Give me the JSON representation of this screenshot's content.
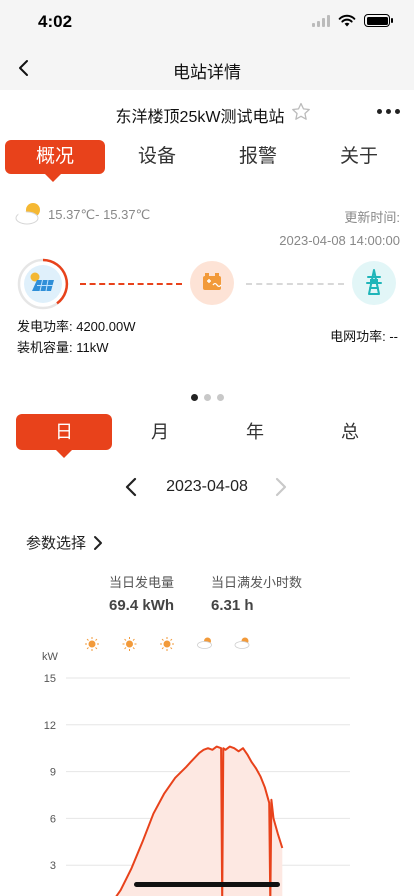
{
  "status_bar": {
    "time": "4:02"
  },
  "nav": {
    "title": "电站详情"
  },
  "station": {
    "name": "东洋楼顶25kW测试电站"
  },
  "main_tabs": [
    {
      "label": "概况",
      "active": true
    },
    {
      "label": "设备",
      "active": false
    },
    {
      "label": "报警",
      "active": false
    },
    {
      "label": "关于",
      "active": false
    }
  ],
  "weather": {
    "icon": "partly-cloudy-icon",
    "temperature": "15.37℃- 15.37℃"
  },
  "update": {
    "label": "更新时间:",
    "value": "2023-04-08 14:00:00"
  },
  "flow": {
    "solar_icon": "solar-panel-icon",
    "inverter_icon": "inverter-icon",
    "grid_icon": "grid-tower-icon",
    "generation_power": "发电功率: 4200.00W",
    "installed_capacity": "装机容量: 11kW",
    "grid_power": "电网功率: --"
  },
  "pager": {
    "count": 3,
    "active_index": 0
  },
  "period_tabs": [
    {
      "label": "日",
      "active": true
    },
    {
      "label": "月",
      "active": false
    },
    {
      "label": "年",
      "active": false
    },
    {
      "label": "总",
      "active": false
    }
  ],
  "date": {
    "value": "2023-04-08"
  },
  "param": {
    "label": "参数选择"
  },
  "summary": {
    "daily_gen_label": "当日发电量",
    "daily_gen_value": "69.4 kWh",
    "full_hours_label": "当日满发小时数",
    "full_hours_value": "6.31 h"
  },
  "colors": {
    "accent": "#e8421b",
    "area": "#fde8e2"
  },
  "chart_data": {
    "type": "area",
    "ylabel": "kW",
    "ylim": [
      0,
      15
    ],
    "yticks": [
      3,
      6,
      9,
      12,
      15
    ],
    "grid": true,
    "weather_icons": [
      "sun-icon",
      "sun-icon",
      "sun-icon",
      "cloud-icon",
      "cloud-icon"
    ],
    "x": [
      7.0,
      7.5,
      8.0,
      8.5,
      9.0,
      9.5,
      10.0,
      10.5,
      11.0,
      11.2,
      11.4,
      11.6,
      11.8,
      12.0,
      12.2,
      12.4,
      12.6,
      12.65,
      12.7,
      12.8,
      13.0,
      13.2,
      13.4,
      13.6,
      13.8,
      14.0,
      14.2,
      14.4,
      14.6,
      14.8,
      14.85,
      14.9,
      15.0,
      15.2,
      15.4
    ],
    "y": [
      0.0,
      0.4,
      1.4,
      2.8,
      4.5,
      6.3,
      7.6,
      8.6,
      9.3,
      9.6,
      9.9,
      10.2,
      10.4,
      10.5,
      10.4,
      10.6,
      10.5,
      0.5,
      10.5,
      10.4,
      10.6,
      10.5,
      10.3,
      10.5,
      10.1,
      9.6,
      9.2,
      8.7,
      8.0,
      7.0,
      0.5,
      7.2,
      6.0,
      5.0,
      4.1
    ],
    "xlim": [
      5.5,
      18.5
    ]
  }
}
